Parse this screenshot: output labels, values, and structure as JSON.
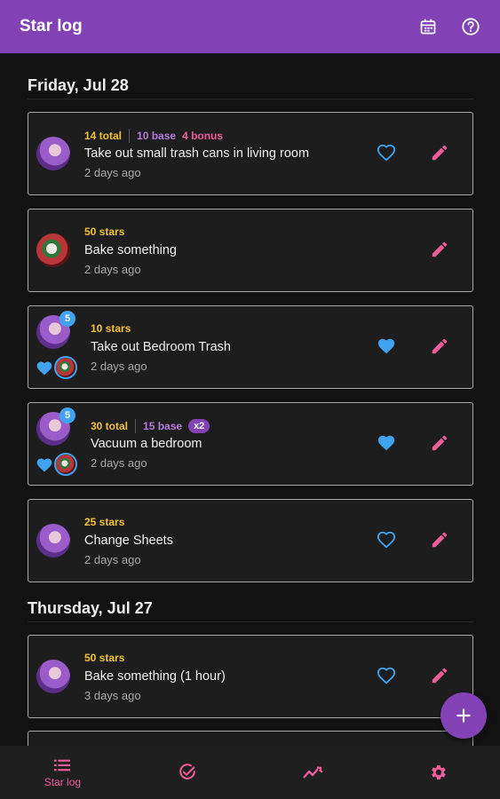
{
  "app": {
    "title": "Star log"
  },
  "colors": {
    "accent": "#8242b5",
    "stars": "#f2c230",
    "base": "#b47ce0",
    "bonus": "#ef5c9a",
    "heart": "#3fa3f0",
    "edit": "#ef5c9a"
  },
  "toolbar": {
    "icons": [
      "calendar-icon",
      "help-icon"
    ]
  },
  "days": [
    {
      "label": "Friday, Jul 28",
      "entries": [
        {
          "total": "14 total",
          "base": "10 base",
          "bonus": "4 bonus",
          "task": "Take out small trash cans in living room",
          "ago": "2 days ago",
          "avatar": "purple",
          "liked": false,
          "can_like": true
        },
        {
          "total": "50 stars",
          "task": "Bake something",
          "ago": "2 days ago",
          "avatar": "red",
          "liked": false,
          "can_like": false
        },
        {
          "total": "10 stars",
          "task": "Take out Bedroom Trash",
          "ago": "2 days ago",
          "avatar": "purple",
          "badge": "5",
          "liked": true,
          "can_like": true,
          "liked_by": "red"
        },
        {
          "total": "30 total",
          "base": "15 base",
          "multiplier": "x2",
          "task": "Vacuum a bedroom",
          "ago": "2 days ago",
          "avatar": "purple",
          "badge": "5",
          "liked": true,
          "can_like": true,
          "liked_by": "red"
        },
        {
          "total": "25 stars",
          "task": "Change Sheets",
          "ago": "2 days ago",
          "avatar": "purple",
          "liked": false,
          "can_like": true
        }
      ]
    },
    {
      "label": "Thursday, Jul 27",
      "entries": [
        {
          "total": "50 stars",
          "task": "Bake something (1 hour)",
          "ago": "3 days ago",
          "avatar": "purple",
          "liked": false,
          "can_like": true
        }
      ]
    }
  ],
  "fab": {
    "icon": "plus-icon"
  },
  "bottom_nav": [
    {
      "label": "Star log",
      "icon": "list-icon",
      "active": true
    },
    {
      "label": "",
      "icon": "check-circle-icon",
      "active": false
    },
    {
      "label": "",
      "icon": "trending-icon",
      "active": false
    },
    {
      "label": "",
      "icon": "settings-icon",
      "active": false
    }
  ]
}
